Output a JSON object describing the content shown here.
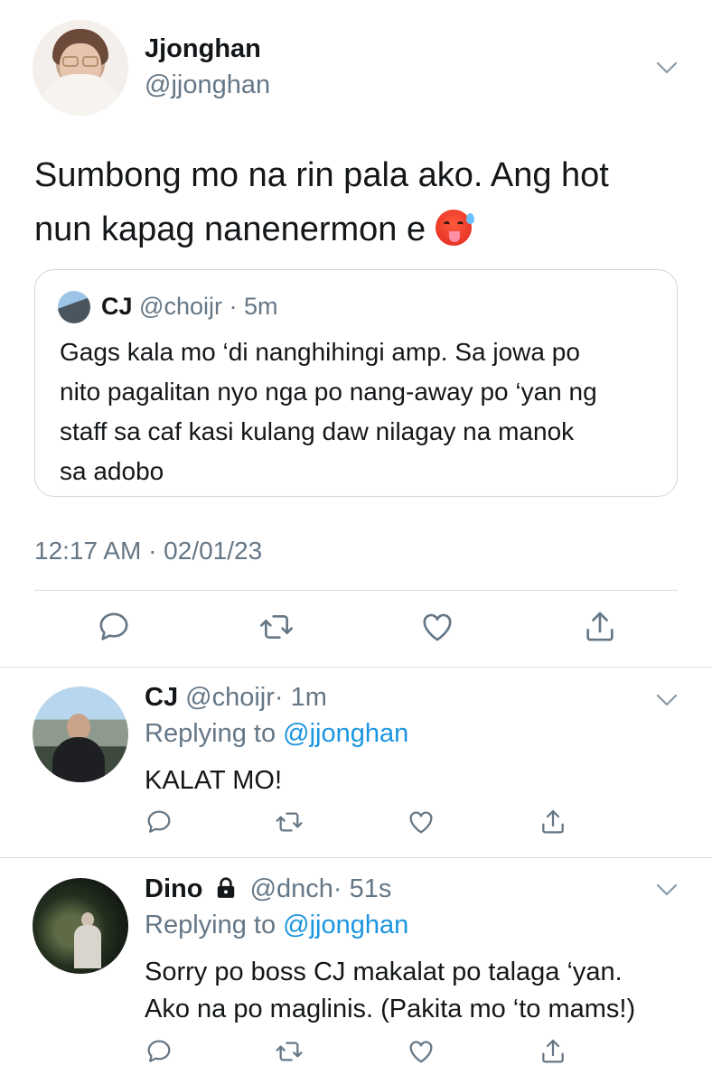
{
  "main_tweet": {
    "display_name": "Jjonghan",
    "handle": "@jjonghan",
    "text_line1": "Sumbong mo na rin pala ako. Ang hot",
    "text_line2": "nun kapag nanenermon e",
    "emoji": "hot-face-emoji",
    "timestamp": "12:17 AM · 02/01/23",
    "quoted": {
      "display_name": "CJ",
      "handle": "@choijr",
      "time": "· 5m",
      "text_line1": "Gags kala mo ‘di nanghihingi amp. Sa jowa po",
      "text_line2": "nito pagalitan nyo nga po nang-away po ‘yan ng",
      "text_line3": "staff sa caf kasi kulang daw nilagay na manok",
      "text_line4": "sa adobo"
    }
  },
  "replies": [
    {
      "display_name": "CJ",
      "handle": "@choijr",
      "time": "· 1m",
      "replying_prefix": "Replying to",
      "replying_to": "@jjonghan",
      "text_line1": "KALAT MO!"
    },
    {
      "display_name": "Dino",
      "protected_icon": "lock-icon",
      "handle": "@dnch",
      "time": "· 51s",
      "replying_prefix": "Replying to",
      "replying_to": "@jjonghan",
      "text_line1": "Sorry po boss CJ makalat po talaga ‘yan.",
      "text_line2": "Ako na po maglinis. (Pakita mo ‘to mams!)"
    }
  ],
  "icons": {
    "reply": "reply-icon",
    "retweet": "retweet-icon",
    "like": "like-icon",
    "share": "share-icon",
    "menu": "chevron-down-icon"
  },
  "colors": {
    "text": "#14171a",
    "secondary": "#657786",
    "mention": "#1b95e0",
    "border": "#ccd6dd"
  }
}
